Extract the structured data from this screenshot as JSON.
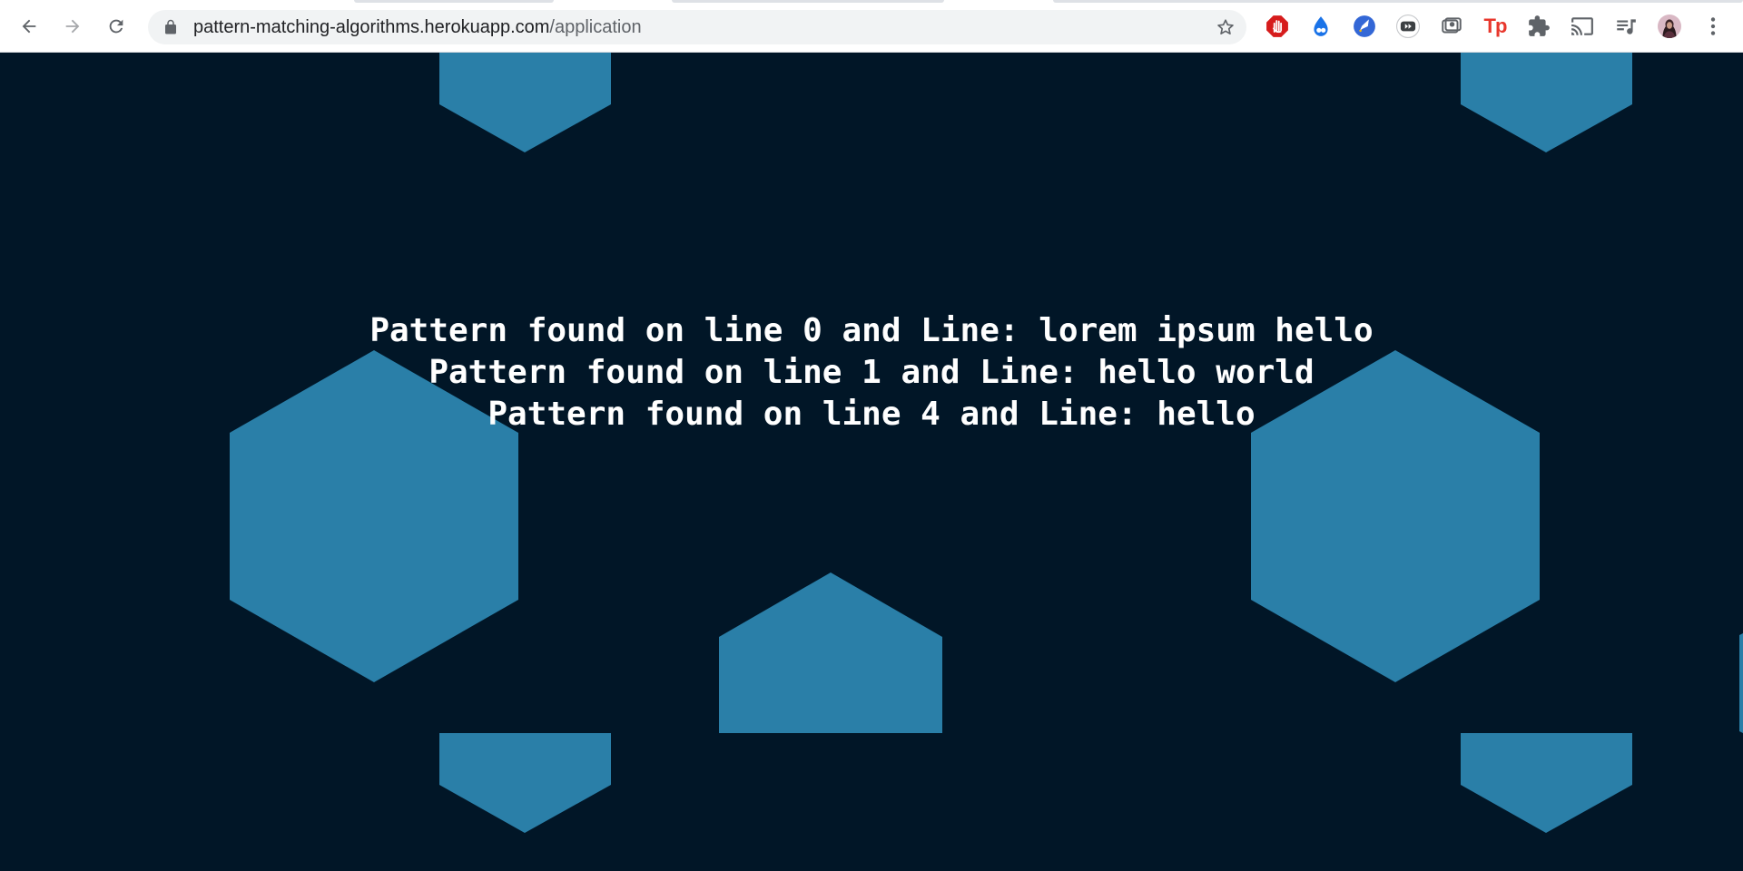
{
  "browser": {
    "url_host": "pattern-matching-algorithms.herokuapp.com",
    "url_path": "/application",
    "nav": {
      "back": "back-arrow-icon",
      "forward": "forward-arrow-icon",
      "reload": "reload-icon"
    },
    "extensions": [
      "stop-hand-extension-icon",
      "blue-drop-extension-icon",
      "rocket-extension-icon",
      "video-speed-extension-icon",
      "screenshot-extension-icon",
      "tp-extension-icon",
      "puzzle-extensions-icon",
      "cast-icon",
      "media-playlist-icon",
      "profile-avatar",
      "kebab-menu-icon"
    ],
    "extension_labels": {
      "tp": "Tp"
    }
  },
  "page": {
    "background_color": "#011627",
    "shape_color": "#2a7fa8",
    "results": [
      "Pattern found on line 0 and Line: lorem ipsum hello",
      "Pattern found on line 1 and Line: hello world",
      "Pattern found on line 4 and Line: hello"
    ]
  }
}
